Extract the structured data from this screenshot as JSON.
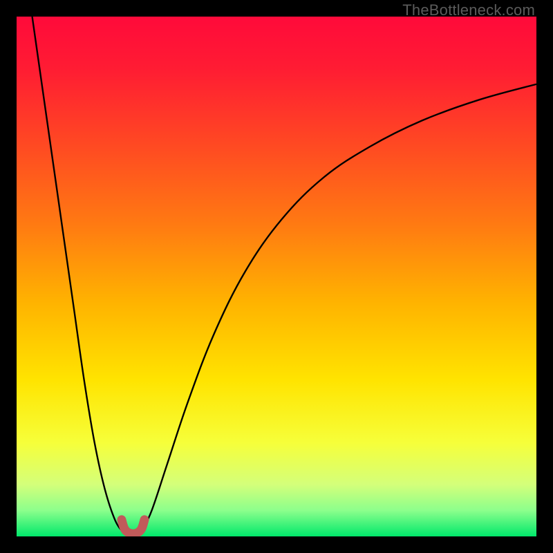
{
  "watermark": "TheBottleneck.com",
  "chart_data": {
    "type": "line",
    "title": "",
    "xlabel": "",
    "ylabel": "",
    "xlim": [
      0,
      100
    ],
    "ylim": [
      0,
      100
    ],
    "grid": false,
    "legend": false,
    "gradient_stops": [
      {
        "offset": 0.0,
        "color": "#ff0a3a"
      },
      {
        "offset": 0.1,
        "color": "#ff1c33"
      },
      {
        "offset": 0.25,
        "color": "#ff4a22"
      },
      {
        "offset": 0.4,
        "color": "#ff7a12"
      },
      {
        "offset": 0.55,
        "color": "#ffb300"
      },
      {
        "offset": 0.7,
        "color": "#ffe400"
      },
      {
        "offset": 0.82,
        "color": "#f6ff3a"
      },
      {
        "offset": 0.9,
        "color": "#d4ff7a"
      },
      {
        "offset": 0.95,
        "color": "#8cff8c"
      },
      {
        "offset": 1.0,
        "color": "#00e86b"
      }
    ],
    "series": [
      {
        "name": "curve-left",
        "stroke": "#000000",
        "stroke_width": 2.4,
        "x": [
          3,
          5,
          7,
          9,
          11,
          13,
          15,
          17,
          19,
          20.5
        ],
        "y": [
          100,
          86,
          72,
          58,
          44,
          30,
          18,
          9,
          3,
          0.8
        ]
      },
      {
        "name": "curve-right",
        "stroke": "#000000",
        "stroke_width": 2.4,
        "x": [
          24,
          26,
          29,
          33,
          38,
          44,
          51,
          59,
          68,
          78,
          89,
          100
        ],
        "y": [
          0.8,
          5,
          14,
          26,
          39,
          51,
          61,
          69,
          75,
          80,
          84,
          87
        ]
      },
      {
        "name": "marker-dip",
        "stroke": "#c15a5a",
        "stroke_width": 13,
        "linecap": "round",
        "x": [
          20.2,
          20.8,
          21.8,
          23.0,
          24.0,
          24.6
        ],
        "y": [
          3.2,
          1.4,
          0.6,
          0.6,
          1.4,
          3.2
        ]
      }
    ]
  }
}
